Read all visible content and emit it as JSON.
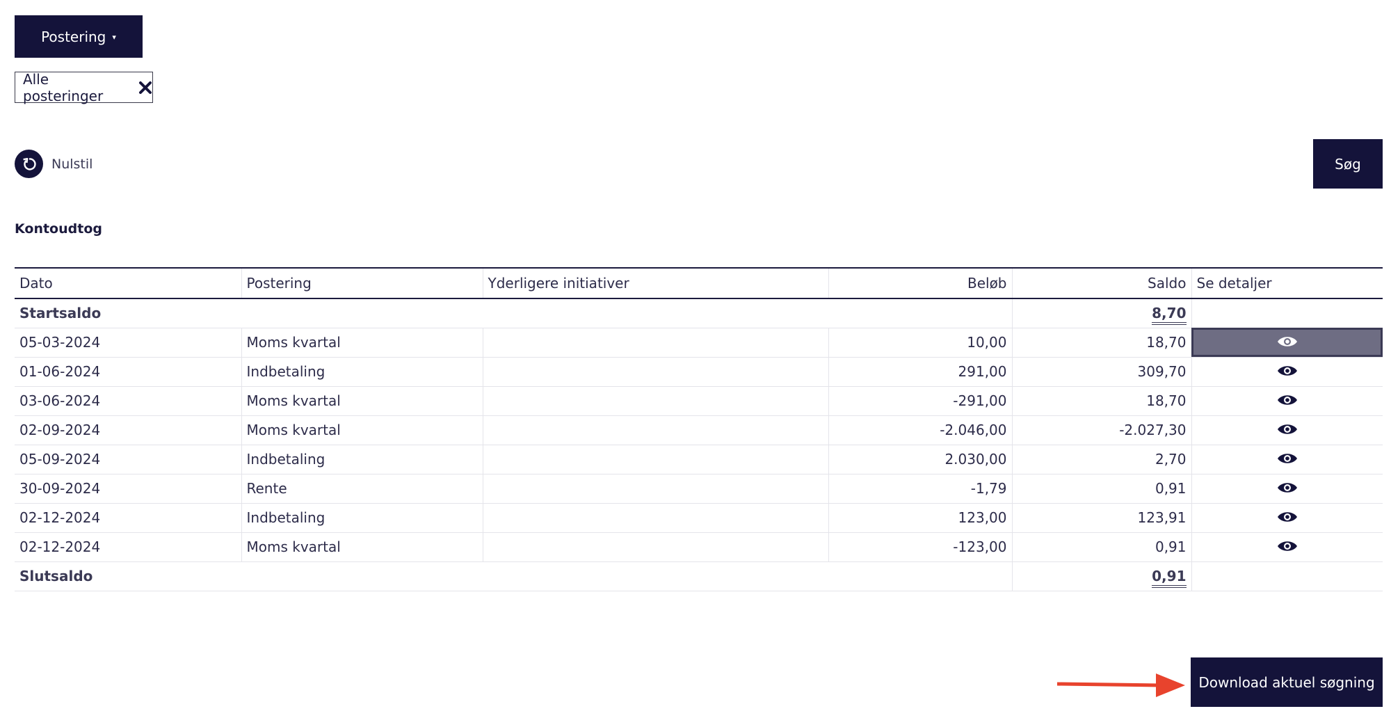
{
  "toolbar": {
    "dropdown_label": "Postering",
    "caret": "▾"
  },
  "filter_chip": {
    "label": "Alle posteringer"
  },
  "reset": {
    "label": "Nulstil"
  },
  "search": {
    "label": "Søg"
  },
  "section": {
    "title": "Kontoudtog"
  },
  "table": {
    "headers": [
      "Dato",
      "Postering",
      "Yderligere initiativer",
      "Beløb",
      "Saldo",
      "Se detaljer"
    ],
    "start": {
      "label": "Startsaldo",
      "saldo": "8,70"
    },
    "rows": [
      {
        "dato": "05-03-2024",
        "postering": "Moms kvartal",
        "initiativer": "",
        "belob": "10,00",
        "saldo": "18,70"
      },
      {
        "dato": "01-06-2024",
        "postering": "Indbetaling",
        "initiativer": "",
        "belob": "291,00",
        "saldo": "309,70"
      },
      {
        "dato": "03-06-2024",
        "postering": "Moms kvartal",
        "initiativer": "",
        "belob": "-291,00",
        "saldo": "18,70"
      },
      {
        "dato": "02-09-2024",
        "postering": "Moms kvartal",
        "initiativer": "",
        "belob": "-2.046,00",
        "saldo": "-2.027,30"
      },
      {
        "dato": "05-09-2024",
        "postering": "Indbetaling",
        "initiativer": "",
        "belob": "2.030,00",
        "saldo": "2,70"
      },
      {
        "dato": "30-09-2024",
        "postering": "Rente",
        "initiativer": "",
        "belob": "-1,79",
        "saldo": "0,91"
      },
      {
        "dato": "02-12-2024",
        "postering": "Indbetaling",
        "initiativer": "",
        "belob": "123,00",
        "saldo": "123,91"
      },
      {
        "dato": "02-12-2024",
        "postering": "Moms kvartal",
        "initiativer": "",
        "belob": "-123,00",
        "saldo": "0,91"
      }
    ],
    "end": {
      "label": "Slutsaldo",
      "saldo": "0,91"
    }
  },
  "download": {
    "label": "Download aktuel søgning"
  },
  "colors": {
    "navy": "#14133a",
    "arrow": "#e8432d",
    "selected_cell": "#6e6d83"
  },
  "icons": {
    "eye": "eye-icon",
    "close": "close-icon",
    "reset": "reset-icon",
    "arrow": "arrow-right-icon"
  }
}
